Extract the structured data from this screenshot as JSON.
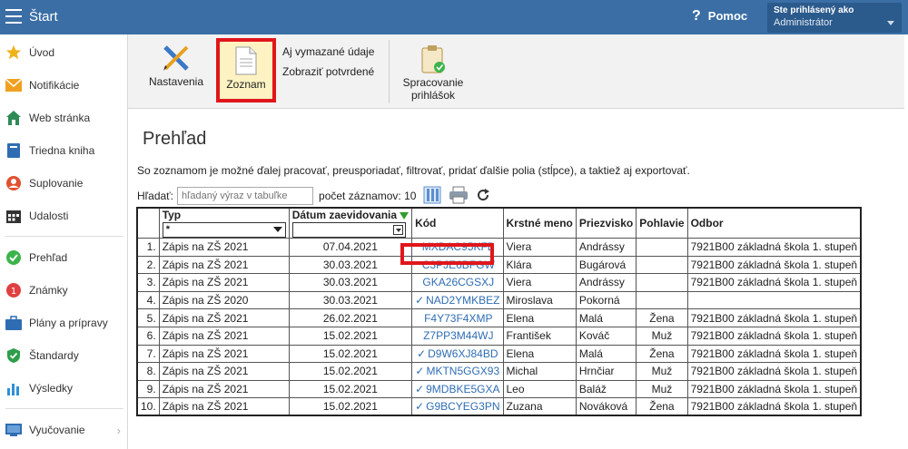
{
  "topbar": {
    "title": "Štart",
    "help_label": "Pomoc",
    "user_label": "Ste prihlásený ako",
    "user_name": "Administrátor"
  },
  "sidebar": {
    "items": [
      {
        "label": "Úvod",
        "icon": "star-icon"
      },
      {
        "label": "Notifikácie",
        "icon": "envelope-icon"
      },
      {
        "label": "Web stránka",
        "icon": "house-icon"
      },
      {
        "label": "Triedna kniha",
        "icon": "book-icon"
      },
      {
        "label": "Suplovanie",
        "icon": "person-icon"
      },
      {
        "label": "Udalosti",
        "icon": "calendar-icon"
      },
      {
        "label": "Prehľad",
        "icon": "check-circle-icon"
      },
      {
        "label": "Známky",
        "icon": "grade-icon"
      },
      {
        "label": "Plány a prípravy",
        "icon": "briefcase-icon"
      },
      {
        "label": "Štandardy",
        "icon": "shield-icon"
      },
      {
        "label": "Výsledky",
        "icon": "bar-chart-icon"
      },
      {
        "label": "Vyučovanie",
        "icon": "board-icon"
      }
    ]
  },
  "ribbon": {
    "settings_label": "Nastavenia",
    "list_label": "Zoznam",
    "show_deleted": "Aj vymazané údaje",
    "show_confirmed": "Zobraziť potvrdené",
    "process_line1": "Spracovanie",
    "process_line2": "prihlášok"
  },
  "content": {
    "title": "Prehľad",
    "description": "So zoznamom je možné ďalej pracovať, preusporiadať, filtrovať, pridať ďalšie polia (stĺpce), a taktiež aj exportovať.",
    "search_label": "Hľadať:",
    "search_placeholder": "hľadaný výraz v tabuľke",
    "count_label": "počet záznamov: 10"
  },
  "table": {
    "headers": {
      "type": "Typ",
      "date": "Dátum zaevidovania",
      "code": "Kód",
      "first": "Krstné meno",
      "last": "Priezvisko",
      "gender": "Pohlavie",
      "field": "Odbor"
    },
    "type_filter": "*",
    "rows": [
      {
        "n": "1.",
        "type": "Zápis na ZŠ 2021",
        "date": "07.04.2021",
        "check": "",
        "code": "MXDAC95KFB",
        "first": "Viera",
        "last": "Andrássy",
        "gender": "",
        "field": "7921B00 základná škola 1. stupeň"
      },
      {
        "n": "2.",
        "type": "Zápis na ZŠ 2021",
        "date": "30.03.2021",
        "check": "",
        "code": "C3PJE6BFGW",
        "first": "Klára",
        "last": "Bugárová",
        "gender": "",
        "field": "7921B00 základná škola 1. stupeň"
      },
      {
        "n": "3.",
        "type": "Zápis na ZŠ 2021",
        "date": "30.03.2021",
        "check": "",
        "code": "GKA26CGSXJ",
        "first": "Viera",
        "last": "Andrássy",
        "gender": "",
        "field": "7921B00 základná škola 1. stupeň"
      },
      {
        "n": "4.",
        "type": "Zápis na ZŠ 2020",
        "date": "30.03.2021",
        "check": "✓",
        "code": "NAD2YMKBEZ",
        "first": "Miroslava",
        "last": "Pokorná",
        "gender": "",
        "field": ""
      },
      {
        "n": "5.",
        "type": "Zápis na ZŠ 2021",
        "date": "26.02.2021",
        "check": "",
        "code": "F4Y73F4XMP",
        "first": "Elena",
        "last": "Malá",
        "gender": "Žena",
        "field": "7921B00 základná škola 1. stupeň"
      },
      {
        "n": "6.",
        "type": "Zápis na ZŠ 2021",
        "date": "15.02.2021",
        "check": "",
        "code": "Z7PP3M44WJ",
        "first": "František",
        "last": "Kováč",
        "gender": "Muž",
        "field": "7921B00 základná škola 1. stupeň"
      },
      {
        "n": "7.",
        "type": "Zápis na ZŠ 2021",
        "date": "15.02.2021",
        "check": "✓",
        "code": "D9W6XJ84BD",
        "first": "Elena",
        "last": "Malá",
        "gender": "Žena",
        "field": "7921B00 základná škola 1. stupeň"
      },
      {
        "n": "8.",
        "type": "Zápis na ZŠ 2021",
        "date": "15.02.2021",
        "check": "✓",
        "code": "MKTN5GGX93",
        "first": "Michal",
        "last": "Hrnčiar",
        "gender": "Muž",
        "field": "7921B00 základná škola 1. stupeň"
      },
      {
        "n": "9.",
        "type": "Zápis na ZŠ 2021",
        "date": "15.02.2021",
        "check": "✓",
        "code": "9MDBKE5GXA",
        "first": "Leo",
        "last": "Baláž",
        "gender": "Muž",
        "field": "7921B00 základná škola 1. stupeň"
      },
      {
        "n": "10.",
        "type": "Zápis na ZŠ 2021",
        "date": "15.02.2021",
        "check": "✓",
        "code": "G9BCYEG3PN",
        "first": "Zuzana",
        "last": "Nováková",
        "gender": "Žena",
        "field": "7921B00 základná škola 1. stupeň"
      }
    ]
  },
  "colors": {
    "topbar": "#3a6ea5",
    "highlight": "#e0161b",
    "link": "#2f6db3"
  }
}
